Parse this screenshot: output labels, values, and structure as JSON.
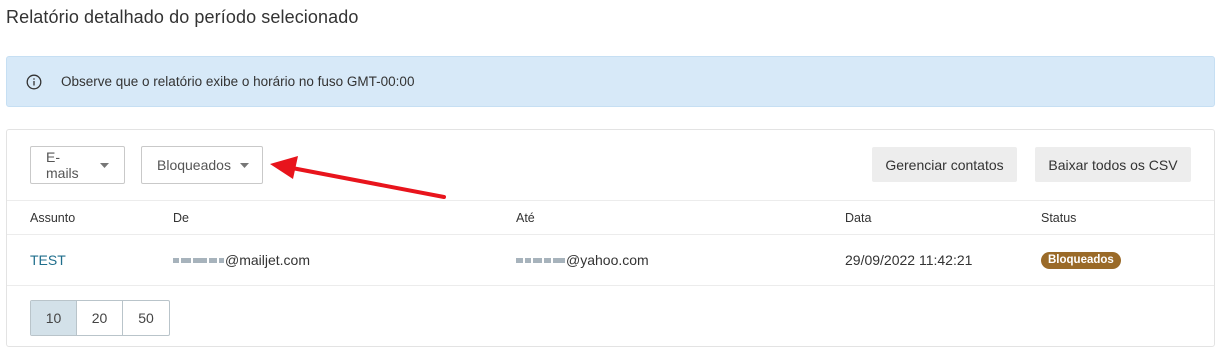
{
  "page": {
    "title": "Relatório detalhado do período selecionado"
  },
  "notice": {
    "icon": "info-icon",
    "text": "Observe que o relatório exibe o horário no fuso GMT-00:00",
    "background": "#d7e9f8"
  },
  "toolbar": {
    "filters": [
      {
        "label": "E-mails",
        "icon": "caret-down-icon"
      },
      {
        "label": "Bloqueados",
        "icon": "caret-down-icon"
      }
    ],
    "actions": {
      "manage_contacts": "Gerenciar contatos",
      "download_csv": "Baixar todos os CSV"
    }
  },
  "table": {
    "columns": [
      "Assunto",
      "De",
      "Até",
      "Data",
      "Status"
    ],
    "rows": [
      {
        "subject": "TEST",
        "from": "@mailjet.com",
        "to": "@yahoo.com",
        "date": "29/09/2022 11:42:21",
        "status": "Bloqueados",
        "status_color": "#9a6a28"
      }
    ]
  },
  "pagination": {
    "options": [
      "10",
      "20",
      "50"
    ],
    "selected": "10"
  },
  "annotation": {
    "arrow_color": "#e8141c"
  }
}
